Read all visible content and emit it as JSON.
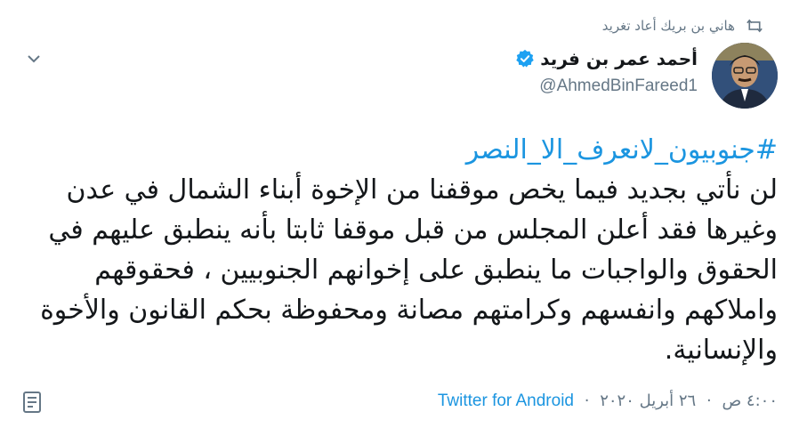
{
  "retweet": {
    "text": "هاني بن بريك أعاد تغريد",
    "icon": "retweet-icon"
  },
  "author": {
    "display_name": "أحمد عمر بن فريد",
    "handle": "@AhmedBinFareed1",
    "verified": true
  },
  "tweet": {
    "hashtag": "#جنوبيون_لانعرف_الا_النصر",
    "text": "لن نأتي بجديد فيما يخص موقفنا من الإخوة أبناء الشمال في عدن وغيرها فقد أعلن المجلس من قبل موقفا ثابتا بأنه ينطبق عليهم في الحقوق والواجبات ما ينطبق على إخوانهم الجنوبيين ، فحقوقهم واملاكهم وانفسهم وكرامتهم مصانة ومحفوظة بحكم القانون والأخوة والإنسانية."
  },
  "meta": {
    "time": "٤:٠٠ ص",
    "date": "٢٦ أبريل ٢٠٢٠",
    "source": "Twitter for Android",
    "separator": "·"
  },
  "colors": {
    "link": "#1b95e0",
    "muted": "#657786",
    "text": "#14171a"
  }
}
